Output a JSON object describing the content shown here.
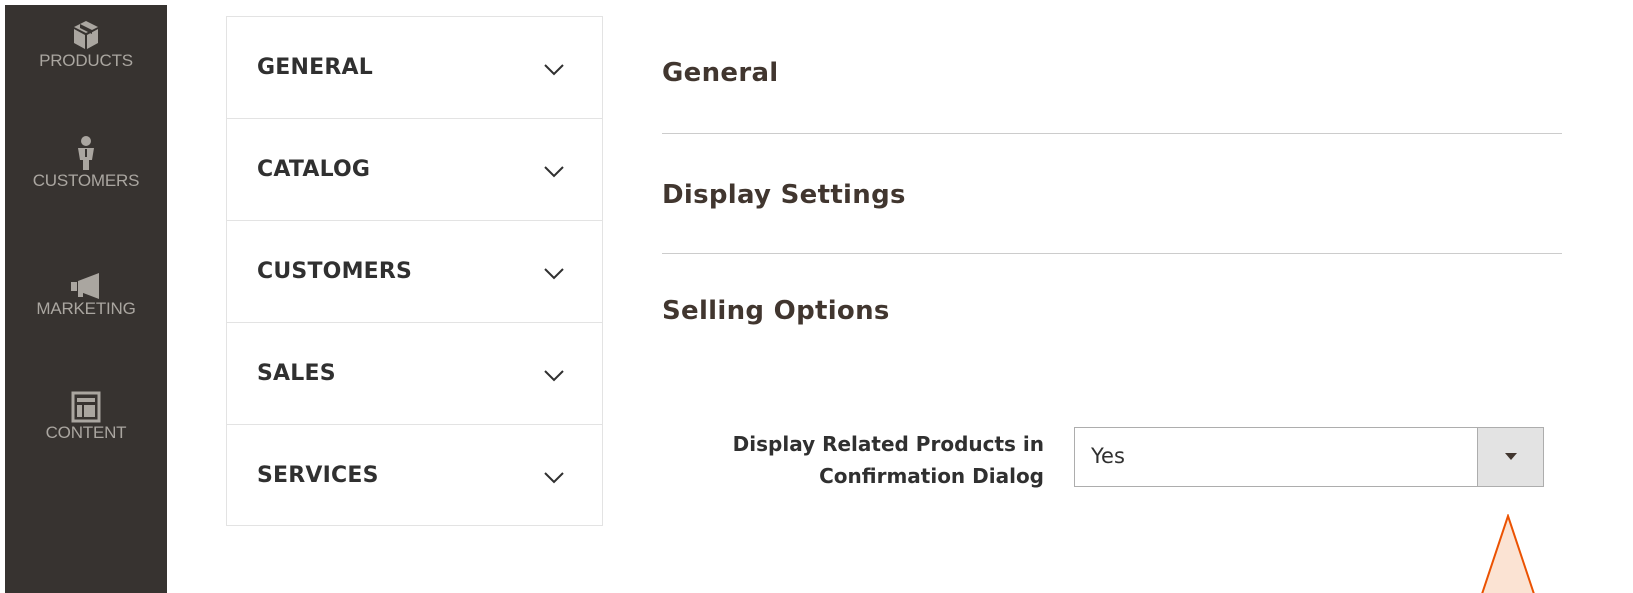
{
  "admin_nav": {
    "items": [
      {
        "label": "PRODUCTS",
        "icon": "box-icon"
      },
      {
        "label": "CUSTOMERS",
        "icon": "person-icon"
      },
      {
        "label": "MARKETING",
        "icon": "megaphone-icon"
      },
      {
        "label": "CONTENT",
        "icon": "layout-icon"
      }
    ]
  },
  "sections": [
    {
      "label": "GENERAL"
    },
    {
      "label": "CATALOG"
    },
    {
      "label": "CUSTOMERS"
    },
    {
      "label": "SALES"
    },
    {
      "label": "SERVICES"
    }
  ],
  "groups": {
    "general": "General",
    "display_settings": "Display Settings",
    "selling_options": "Selling Options"
  },
  "field": {
    "label_line1": "Display Related Products in",
    "label_line2": "Confirmation Dialog",
    "value": "Yes"
  },
  "colors": {
    "sidebar_bg": "#373330",
    "annotation_accent": "#eb5202"
  }
}
